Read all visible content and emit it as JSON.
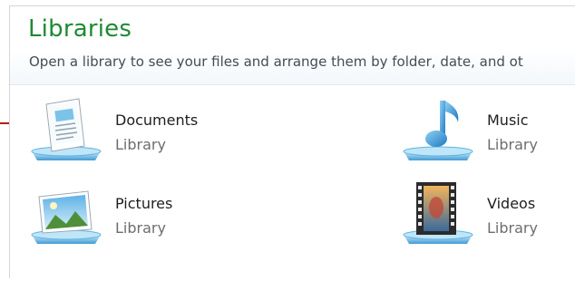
{
  "header": {
    "title": "Libraries",
    "subtitle": "Open a library to see your files and arrange them by folder, date, and ot"
  },
  "libraries": [
    {
      "name": "Documents",
      "type": "Library",
      "icon": "documents-library-icon"
    },
    {
      "name": "Music",
      "type": "Library",
      "icon": "music-library-icon"
    },
    {
      "name": "Pictures",
      "type": "Library",
      "icon": "pictures-library-icon"
    },
    {
      "name": "Videos",
      "type": "Library",
      "icon": "videos-library-icon"
    }
  ],
  "colors": {
    "title": "#1e8a34",
    "arrow": "#b01e1e",
    "icon_blue": "#4aa3d9"
  }
}
